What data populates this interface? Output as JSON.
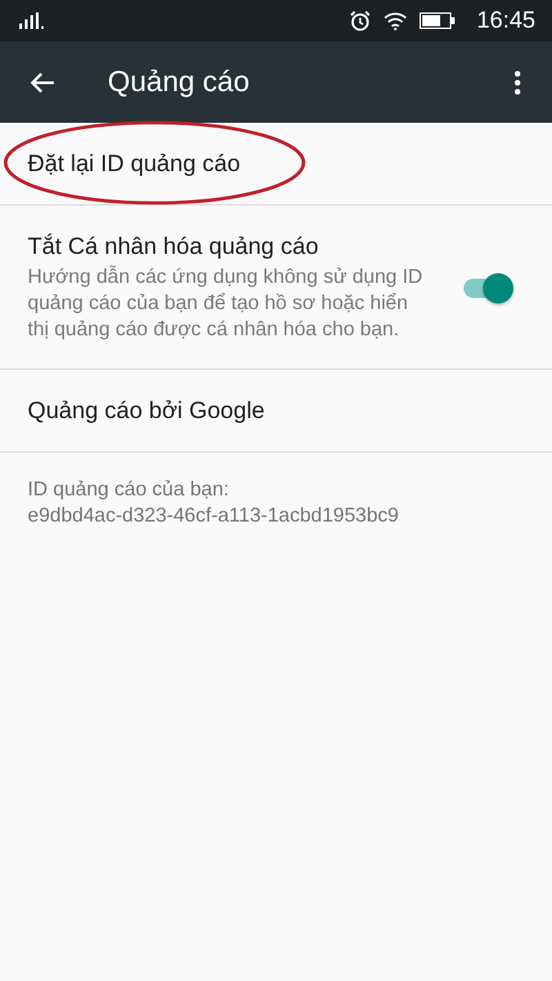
{
  "status_bar": {
    "time": "16:45"
  },
  "toolbar": {
    "title": "Quảng cáo"
  },
  "items": [
    {
      "kind": "action",
      "title": "Đặt lại ID quảng cáo",
      "circled": true
    },
    {
      "kind": "switch",
      "title": "Tắt Cá nhân hóa quảng cáo",
      "summary": "Hướng dẫn các ứng dụng không sử dụng ID quảng cáo của bạn để tạo hồ sơ hoặc hiển thị quảng cáo được cá nhân hóa cho bạn.",
      "on": true,
      "circled": false
    },
    {
      "kind": "action",
      "title": "Quảng cáo bởi Google",
      "circled": false
    },
    {
      "kind": "footer",
      "lines": [
        "ID quảng cáo của bạn:",
        "e9dbd4ac-d323-46cf-a113-1acbd1953bc9"
      ]
    }
  ]
}
